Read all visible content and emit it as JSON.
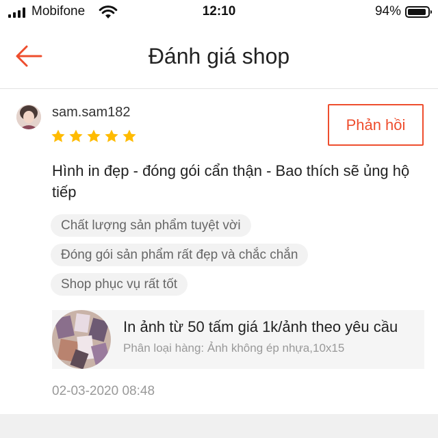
{
  "status_bar": {
    "carrier": "Mobifone",
    "time": "12:10",
    "battery_percent_text": "94%",
    "battery_level": 0.94,
    "signal_icon": "cellular-signal-icon",
    "wifi_icon": "wifi-icon",
    "battery_icon": "battery-icon"
  },
  "header": {
    "back_icon": "arrow-left-icon",
    "title": "Đánh giá shop"
  },
  "review": {
    "username": "sam.sam182",
    "rating": 5,
    "rating_max": 5,
    "reply_label": "Phản hồi",
    "comment": "Hình in đẹp - đóng gói cẩn thận - Bao thích sẽ ủng hộ tiếp",
    "tags": [
      "Chất lượng sản phẩm tuyệt vời",
      "Đóng gói sản phẩm rất đẹp và chắc chắn",
      "Shop phục vụ rất tốt"
    ],
    "product": {
      "name": "In ảnh từ 50 tấm giá 1k/ảnh theo yêu cầu",
      "variant": "Phân loại hàng: Ảnh không ép nhựa,10x15"
    },
    "timestamp": "02-03-2020 08:48"
  },
  "colors": {
    "accent": "#ee4d2d",
    "star": "#ffbb00",
    "tag_bg": "#f2f2f2",
    "muted_text": "#999999"
  }
}
